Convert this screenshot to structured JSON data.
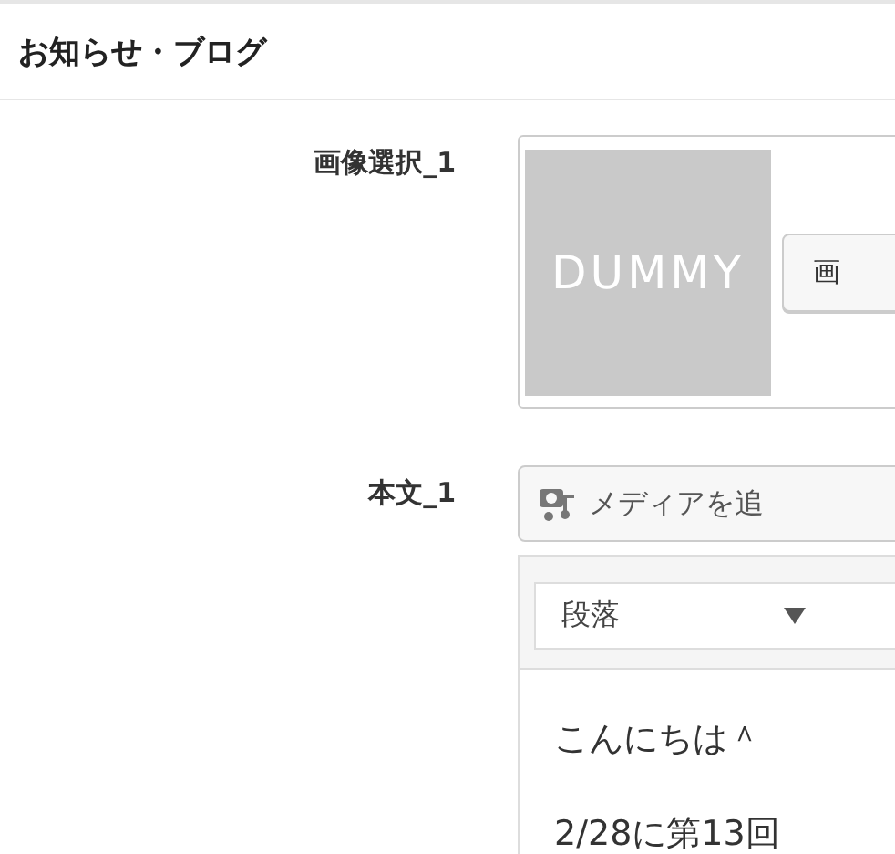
{
  "header": {
    "title": "お知らせ・ブログ"
  },
  "image_field": {
    "label": "画像選択_1",
    "placeholder_text": "DUMMY",
    "button": "画"
  },
  "body_field": {
    "label": "本文_1",
    "media_button": "メディアを追",
    "format_select": "段落",
    "content": [
      "こんにちは＾",
      "2/28に第13回"
    ]
  }
}
